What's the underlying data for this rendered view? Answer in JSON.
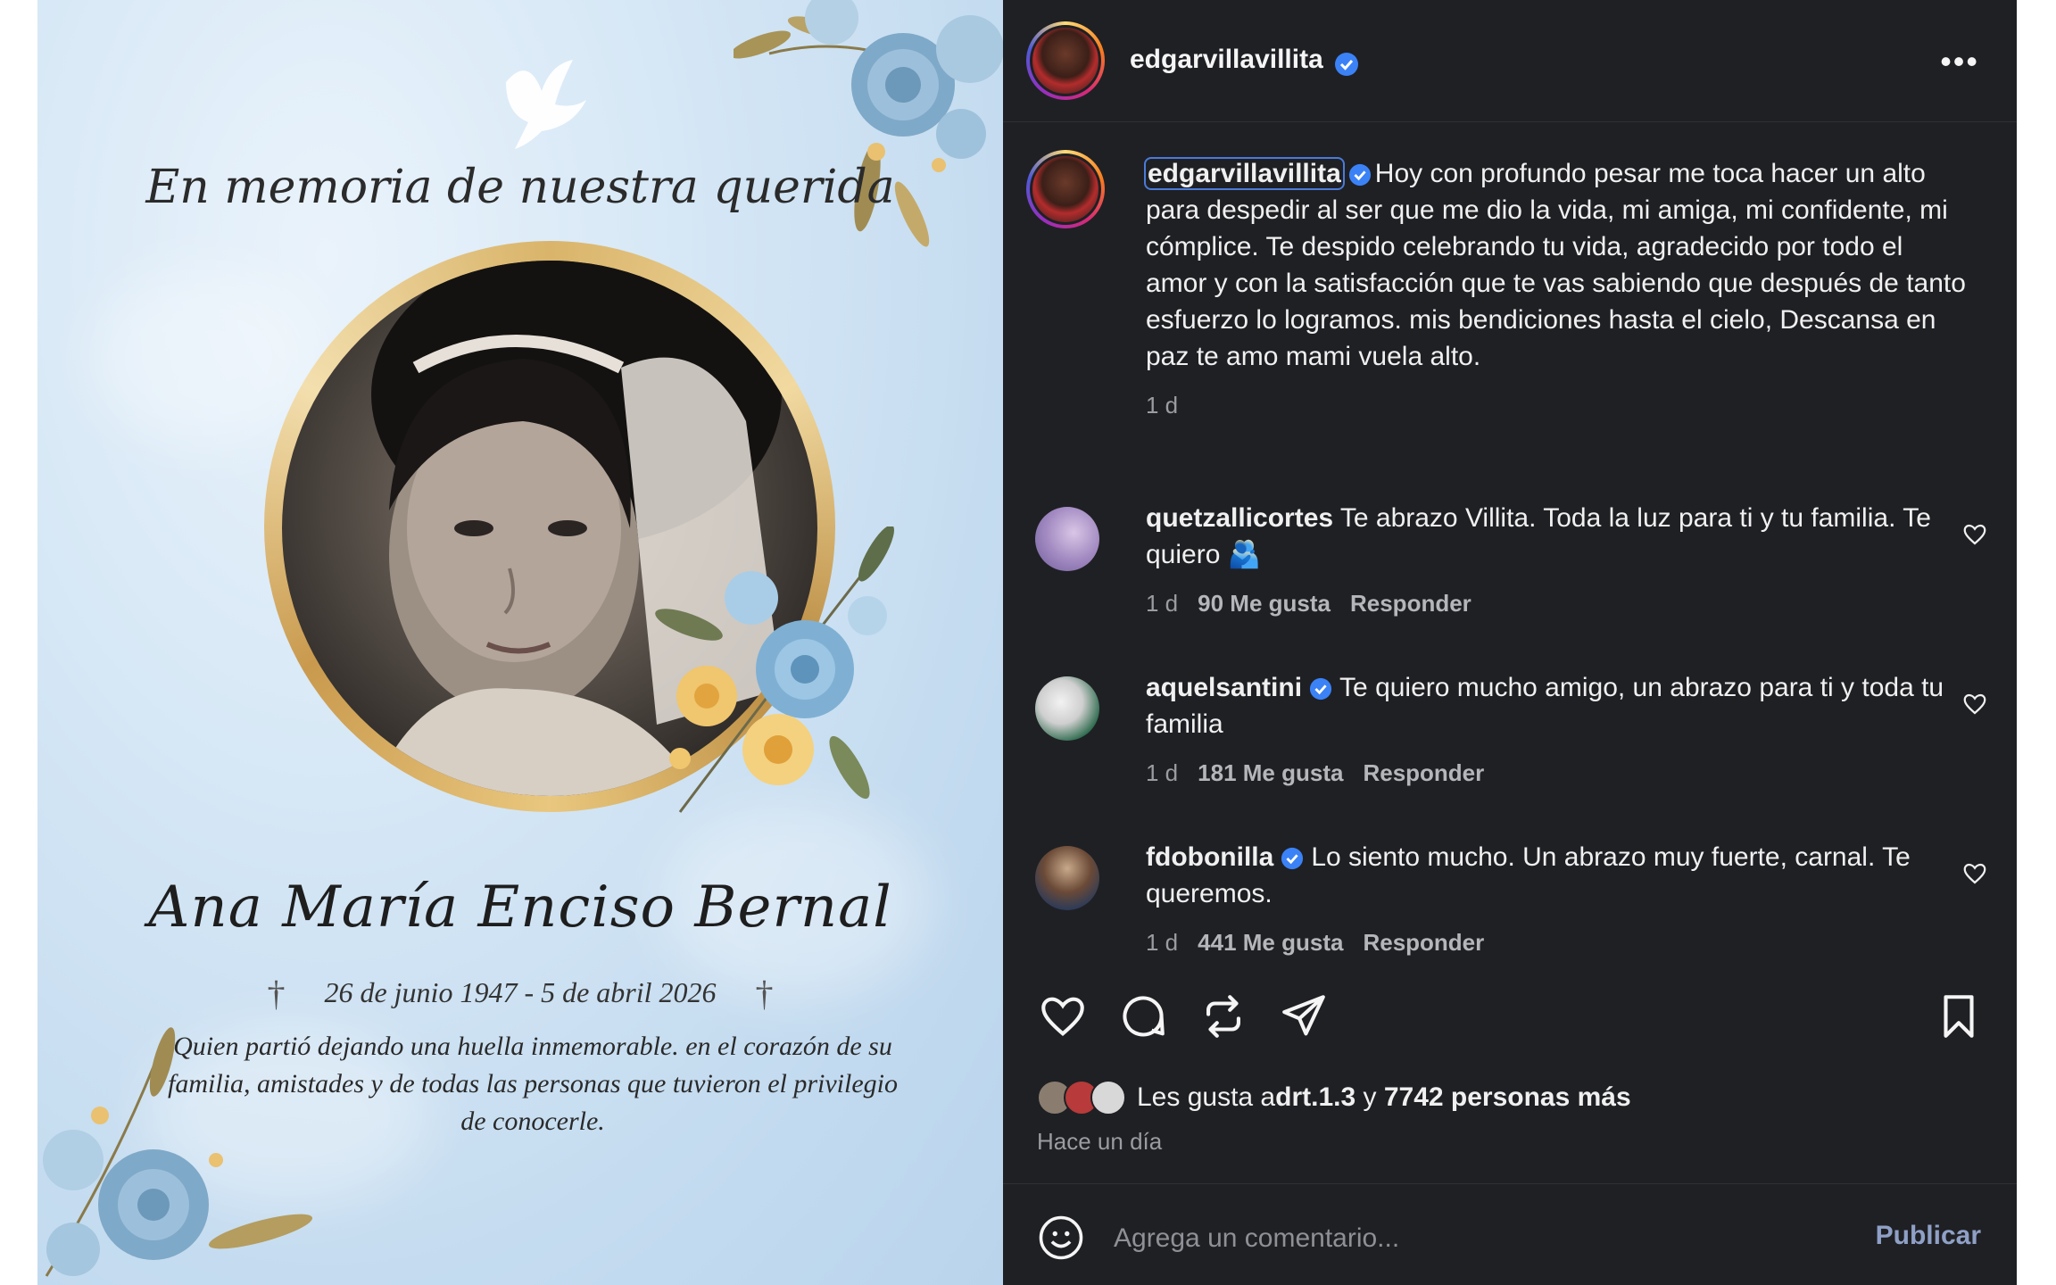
{
  "memorial": {
    "heading": "En memoria de nuestra querida",
    "name": "Ana María Enciso Bernal",
    "dates": "26 de junio 1947 - 5 de abril 2026",
    "cross": "†",
    "epitaph": "Quien partió dejando una huella inmemorable.  en el corazón de su familia, amistades y de todas las personas que tuvieron el privilegio de conocerle."
  },
  "post": {
    "author": "edgarvillavillita",
    "more_label": "•••",
    "caption": {
      "user": "edgarvillavillita",
      "text": "Hoy con profundo pesar me toca hacer un alto para despedir al ser que me dio la vida, mi amiga, mi confidente, mi cómplice. Te despido celebrando tu vida, agradecido por todo el amor y con la satisfacción que te vas sabiendo que después de tanto esfuerzo lo logramos. mis bendiciones hasta el cielo, Descansa en paz te amo mami vuela alto.",
      "time": "1 d"
    },
    "comments": [
      {
        "user": "quetzallicortes",
        "verified": false,
        "text": "Te abrazo Villita. Toda la luz para ti y tu familia. Te quiero 🫂",
        "time": "1 d",
        "likes": "90 Me gusta",
        "reply": "Responder"
      },
      {
        "user": "aquelsantini",
        "verified": true,
        "text": "Te quiero mucho amigo, un abrazo para ti y toda tu familia",
        "time": "1 d",
        "likes": "181 Me gusta",
        "reply": "Responder"
      },
      {
        "user": "fdobonilla",
        "verified": true,
        "text": "Lo siento mucho. Un abrazo muy fuerte, carnal. Te queremos.",
        "time": "1 d",
        "likes": "441 Me gusta",
        "reply": "Responder"
      }
    ],
    "likes": {
      "prefix": "Les gusta a ",
      "first": "drt.1.3",
      "middle": " y ",
      "rest": "7742 personas más"
    },
    "posted_ago": "Hace un día",
    "comment_box": {
      "placeholder": "Agrega un comentario...",
      "publish": "Publicar"
    },
    "icons": [
      "heart-icon",
      "comment-icon",
      "repost-icon",
      "share-icon",
      "bookmark-icon",
      "emoji-icon",
      "verified-icon"
    ],
    "colors": {
      "panel_bg": "#1f2024",
      "verified": "#3b82f6",
      "muted": "#9a9ca1",
      "publish": "#8fa0c6"
    }
  }
}
